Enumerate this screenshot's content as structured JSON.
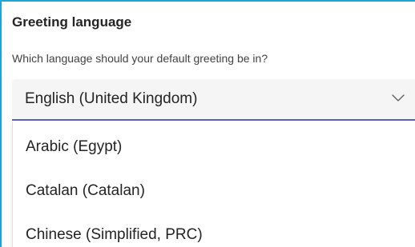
{
  "section": {
    "title": "Greeting language",
    "description": "Which language should your default greeting be in?"
  },
  "select": {
    "selected_value": "English (United Kingdom)",
    "icon": "chevron-down-icon",
    "accent_color": "#5b5fc7"
  },
  "dropdown": {
    "options": [
      {
        "label": "Arabic (Egypt)"
      },
      {
        "label": "Catalan (Catalan)"
      },
      {
        "label": "Chinese (Simplified, PRC)"
      }
    ]
  },
  "colors": {
    "focus_frame": "#1aa6d9",
    "text": "#242424"
  }
}
